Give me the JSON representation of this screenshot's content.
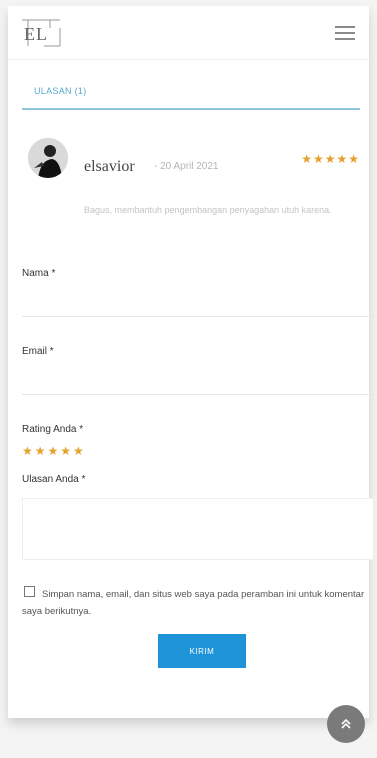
{
  "header": {
    "logo_text": "EL",
    "menu_icon": "hamburger-icon"
  },
  "tabs": [
    {
      "label": "ULASAN (1)"
    }
  ],
  "review": {
    "author": "elsavior",
    "date": "- 20 April 2021",
    "stars": "★★★★★",
    "text": "Bagus, membantuh pengembangan penyagahan utuh karena."
  },
  "form": {
    "name_label": "Nama *",
    "email_label": "Email *",
    "rating_label": "Rating Anda *",
    "rating_stars": "★★★★★",
    "review_label": "Ulasan Anda *",
    "consent_text": "Simpan nama, email, dan situs web saya pada peramban ini untuk komentar saya berikutnya.",
    "submit_label": "KIRIM"
  },
  "colors": {
    "accent": "#1f93d8",
    "tab_underline": "#8fc4dc",
    "star": "#e6a12a"
  },
  "icons": {
    "scroll_top": "double-chevron-up-icon"
  }
}
